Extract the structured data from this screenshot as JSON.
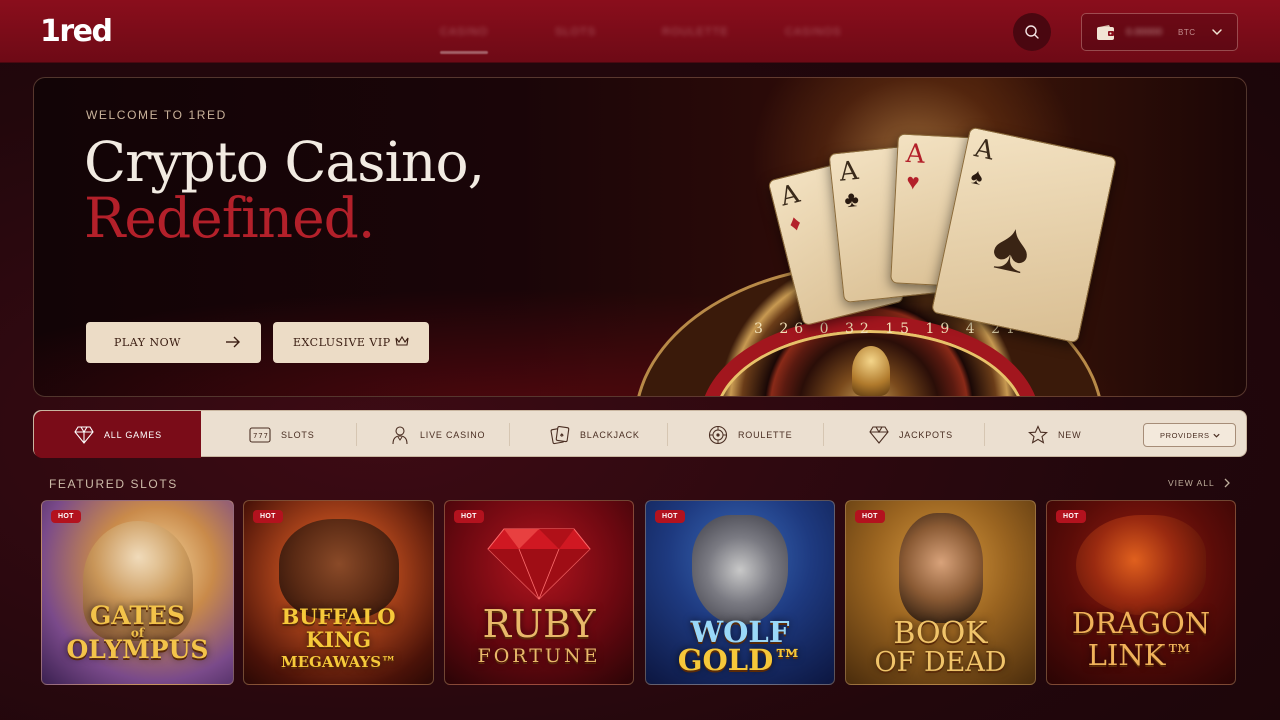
{
  "brand": {
    "logo": "1red"
  },
  "nav": {
    "items": [
      "Casino",
      "Slots",
      "Roulette",
      "Casinos"
    ]
  },
  "wallet": {
    "balance": "0.00000",
    "currency": "BTC"
  },
  "hero": {
    "eyebrow": "WELCOME TO 1RED",
    "title_line1": "Crypto Casino,",
    "title_line2": "Redefined.",
    "description": "",
    "play_label": "PLAY NOW",
    "vip_label": "EXCLUSIVE VIP",
    "cards": [
      "A",
      "A",
      "A",
      "A"
    ],
    "roulette_numbers": "3 26 0 32 15 19 4 21"
  },
  "categories": [
    {
      "label": "ALL GAMES",
      "icon": "diamond-icon",
      "active": true
    },
    {
      "label": "SLOTS",
      "icon": "slot-machine-icon"
    },
    {
      "label": "LIVE CASINO",
      "icon": "dealer-icon"
    },
    {
      "label": "BLACKJACK",
      "icon": "cards-icon"
    },
    {
      "label": "ROULETTE",
      "icon": "roulette-icon"
    },
    {
      "label": "JACKPOTS",
      "icon": "diamond-icon"
    },
    {
      "label": "NEW",
      "icon": "star-icon"
    }
  ],
  "providers_label": "PROVIDERS",
  "featured": {
    "title": "FEATURED SLOTS",
    "view_all": "VIEW ALL",
    "games": [
      {
        "badge": "HOT",
        "title_lines": [
          "GATES",
          "of",
          "OLYMPUS"
        ]
      },
      {
        "badge": "HOT",
        "title_lines": [
          "BUFFALO",
          "KING",
          "MEGAWAYS™"
        ]
      },
      {
        "badge": "HOT",
        "title_lines": [
          "RUBY",
          "FORTUNE"
        ]
      },
      {
        "badge": "HOT",
        "title_lines": [
          "WOLF",
          "GOLD™"
        ]
      },
      {
        "badge": "HOT",
        "title_lines": [
          "BOOK",
          "OF DEAD"
        ]
      },
      {
        "badge": "HOT",
        "title_lines": [
          "DRAGON",
          "LINK™"
        ]
      }
    ]
  },
  "colors": {
    "brand_red": "#8a0e1c",
    "accent_red": "#b3202a",
    "cream": "#ebdfd0",
    "hot_badge": "#b3121e"
  }
}
